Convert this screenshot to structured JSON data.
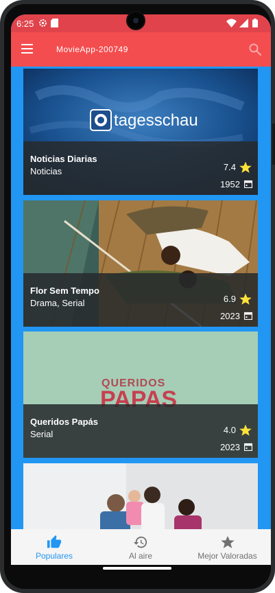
{
  "status_bar": {
    "time": "6:25"
  },
  "app_bar": {
    "title": "MovieApp-200749"
  },
  "cards": [
    {
      "title": "Noticias Diarias",
      "genre": "Noticias",
      "rating": "7.4",
      "year": "1952",
      "image_text": "tagesschau"
    },
    {
      "title": "Flor Sem Tempo",
      "genre": "Drama, Serial",
      "rating": "6.9",
      "year": "2023"
    },
    {
      "title": "Queridos Papás",
      "genre": "Serial",
      "rating": "4.0",
      "year": "2023",
      "image_text_top": "QUERIDOS",
      "image_text_bottom": "PAPAS"
    },
    {
      "title": "",
      "genre": ""
    }
  ],
  "bottom_nav": [
    {
      "label": "Populares",
      "icon": "thumb-up-icon",
      "active": true
    },
    {
      "label": "Al aire",
      "icon": "history-icon",
      "active": false
    },
    {
      "label": "Mejor Valoradas",
      "icon": "star-icon",
      "active": false
    }
  ],
  "colors": {
    "app_bar": "#f44d4f",
    "list_bg": "#2196f3",
    "active_nav": "#2196f3",
    "star": "#fde23a"
  }
}
